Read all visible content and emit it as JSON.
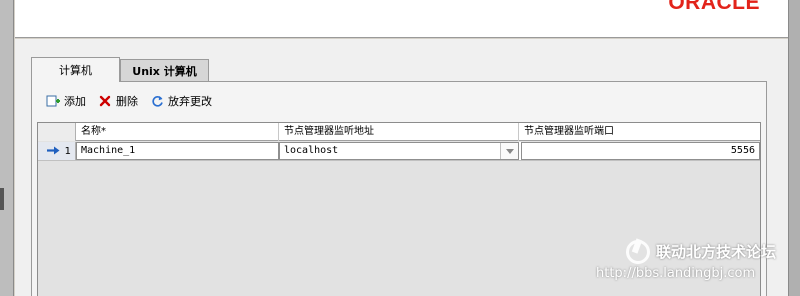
{
  "header": {
    "logo": "ORACLE"
  },
  "tabs": [
    {
      "label": "计算机",
      "active": true
    },
    {
      "label": "Unix 计算机",
      "active": false
    }
  ],
  "toolbar": {
    "add_label": "添加",
    "delete_label": "删除",
    "revert_label": "放弃更改"
  },
  "table": {
    "columns": [
      "名称*",
      "节点管理器监听地址",
      "节点管理器监听端口"
    ],
    "rows": [
      {
        "index": "1",
        "name": "Machine_1",
        "address": "localhost",
        "port": "5556"
      }
    ]
  },
  "watermark": {
    "title": "联动北方技术论坛",
    "url": "http://bbs.landingbj.com"
  },
  "colors": {
    "logo": "#e2231a",
    "row_arrow": "#1f5fbf",
    "delete_icon": "#cc0000"
  }
}
